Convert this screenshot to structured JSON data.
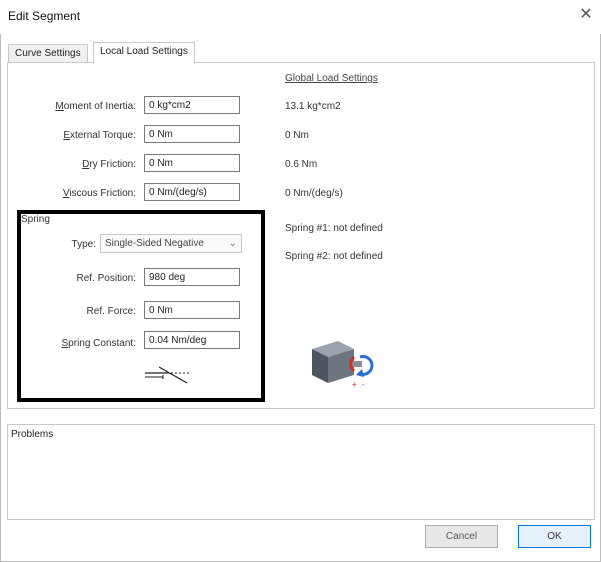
{
  "window": {
    "title": "Edit Segment",
    "close_glyph": "✕"
  },
  "tabs": [
    {
      "label": "Curve Settings",
      "active": false
    },
    {
      "label": "Local Load Settings",
      "active": true
    }
  ],
  "global": {
    "heading": "Global Load Settings",
    "moment": "13.1 kg*cm2",
    "torque": "0 Nm",
    "dry": "0.6 Nm",
    "viscous": "0 Nm/(deg/s)",
    "spring1": "Spring #1: not defined",
    "spring2": "Spring #2: not defined"
  },
  "local": {
    "moment": {
      "acc": "M",
      "rest": "oment of Inertia:",
      "value": "0 kg*cm2"
    },
    "torque": {
      "acc": "E",
      "rest": "xternal Torque:",
      "value": "0 Nm"
    },
    "dry": {
      "pre": "",
      "acc": "D",
      "rest": "ry Friction:",
      "value": "0 Nm"
    },
    "viscous": {
      "acc": "V",
      "rest": "iscous Friction:",
      "value": "0 Nm/(deg/s)"
    }
  },
  "spring": {
    "group_label": "Spring",
    "type_label": "Type:",
    "type_value": "Single-Sided Negative",
    "ref_position_label": "Ref. Position:",
    "ref_position_value": "980 deg",
    "ref_force_label": "Ref. Force:",
    "ref_force_value": "0 Nm",
    "constant_acc": "S",
    "constant_rest": "pring Constant:",
    "constant_value": "0.04 Nm/deg",
    "diagram_icon": "spring-negative-diagram-icon"
  },
  "motor_icon": "motor-rotation-icon",
  "problems": {
    "title": "Problems"
  },
  "buttons": {
    "cancel": "Cancel",
    "ok": "OK"
  },
  "colors": {
    "accent": "#0078d7",
    "highlight_box": "#000000",
    "motor_blue": "#2b6cd6",
    "motor_red": "#d0302a"
  }
}
